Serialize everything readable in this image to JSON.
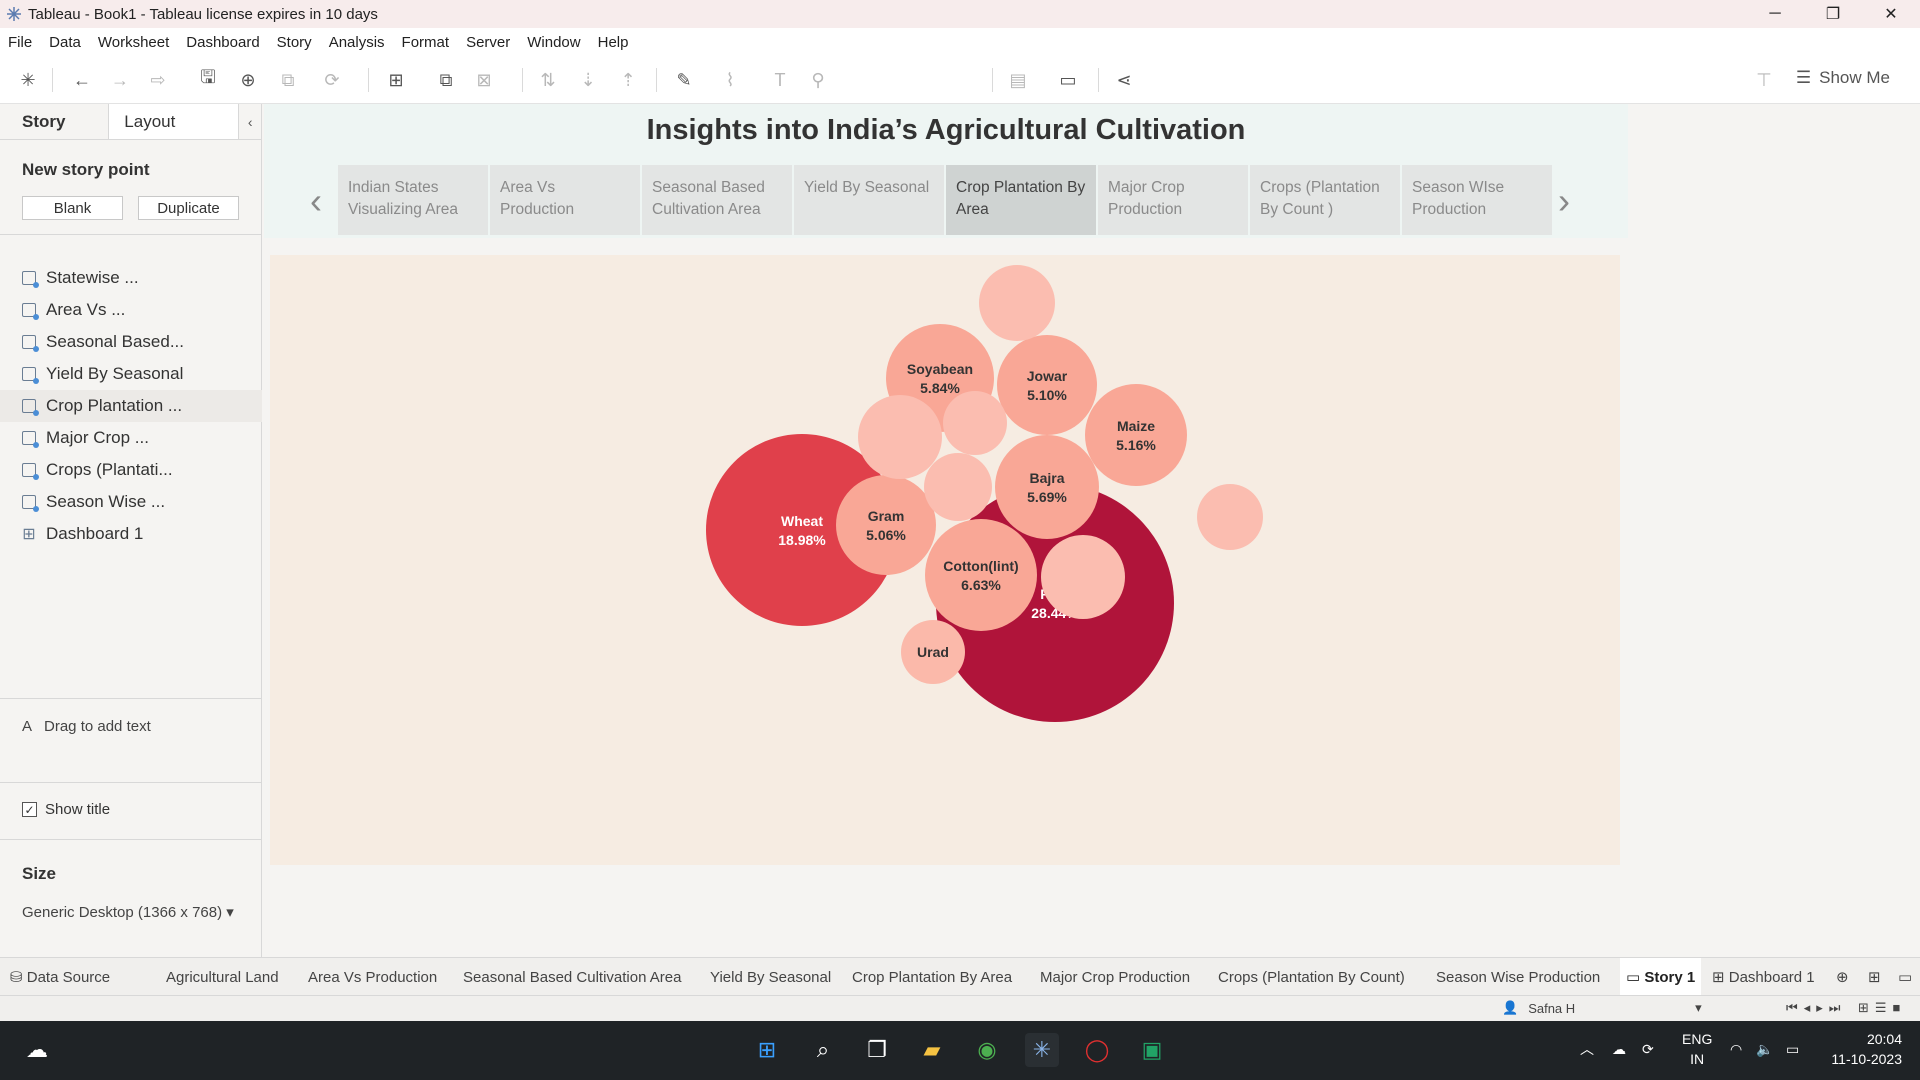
{
  "window": {
    "title": "Tableau - Book1 - Tableau license expires in 10 days",
    "minimize": "─",
    "restore": "❐",
    "close": "✕"
  },
  "menu": [
    "File",
    "Data",
    "Worksheet",
    "Dashboard",
    "Story",
    "Analysis",
    "Format",
    "Server",
    "Window",
    "Help"
  ],
  "toolbar": {
    "show_me": "Show Me"
  },
  "left_pane": {
    "tab_story": "Story",
    "tab_layout": "Layout",
    "new_story_point": "New story point",
    "blank_button": "Blank",
    "duplicate_button": "Duplicate",
    "sheets": [
      "Statewise ...",
      "Area Vs ...",
      "Seasonal Based...",
      "Yield By Seasonal",
      "Crop Plantation ...",
      "Major Crop ...",
      "Crops (Plantati...",
      "Season Wise ...",
      "Dashboard 1"
    ],
    "drag_text": "Drag to add text",
    "show_title": "Show title",
    "size_heading": "Size",
    "size_value": "Generic Desktop (1366 x 768)"
  },
  "story": {
    "title": "Insights into India’s Agricultural Cultivation",
    "points": [
      "Indian States Visualizing Area",
      "Area Vs Production",
      "Seasonal Based Cultivation Area",
      "Yield By Seasonal",
      "Crop Plantation By Area",
      "Major Crop Production",
      "Crops (Plantation By Count )",
      "Season WIse Production"
    ]
  },
  "chart_data": {
    "type": "packed-bubble",
    "measure": "Percent of total cultivation area by crop",
    "bubbles": [
      {
        "name": "Rice",
        "value": 28.44,
        "label": "28.44%",
        "color": "#b0143a"
      },
      {
        "name": "Wheat",
        "value": 18.98,
        "label": "18.98%",
        "color": "#e0404b"
      },
      {
        "name": "Cotton(lint)",
        "value": 6.63,
        "label": "6.63%",
        "color": "#f9a796"
      },
      {
        "name": "Soyabean",
        "value": 5.84,
        "label": "5.84%",
        "color": "#f9a796"
      },
      {
        "name": "Bajra",
        "value": 5.69,
        "label": "5.69%",
        "color": "#f9a796"
      },
      {
        "name": "Maize",
        "value": 5.16,
        "label": "5.16%",
        "color": "#f9a796"
      },
      {
        "name": "Jowar",
        "value": 5.1,
        "label": "5.10%",
        "color": "#f9a796"
      },
      {
        "name": "Gram",
        "value": 5.06,
        "label": "5.06%",
        "color": "#f9a796"
      },
      {
        "name": "Urad",
        "value": null,
        "label": "",
        "color": "#fbb9aa"
      },
      {
        "name": "",
        "value": null,
        "label": "",
        "color": "#fbbdb0"
      },
      {
        "name": "",
        "value": null,
        "label": "",
        "color": "#fbbdb0"
      },
      {
        "name": "",
        "value": null,
        "label": "",
        "color": "#fbbdb0"
      },
      {
        "name": "",
        "value": null,
        "label": "",
        "color": "#fbbdb0"
      },
      {
        "name": "",
        "value": null,
        "label": "",
        "color": "#fbbdb0"
      },
      {
        "name": "",
        "value": null,
        "label": "",
        "color": "#fbbdb0"
      }
    ]
  },
  "sheet_tabs": [
    "Data Source",
    "Agricultural Land",
    "Area Vs Production",
    "Seasonal Based Cultivation Area",
    "Yield By Seasonal",
    "Crop Plantation By Area",
    "Major Crop Production",
    "Crops (Plantation By Count)",
    "Season Wise Production",
    "Story 1",
    "Dashboard 1"
  ],
  "status": {
    "user": "Safna H"
  },
  "taskbar": {
    "lang1": "ENG",
    "lang2": "IN",
    "time": "20:04",
    "date": "11-10-2023"
  }
}
